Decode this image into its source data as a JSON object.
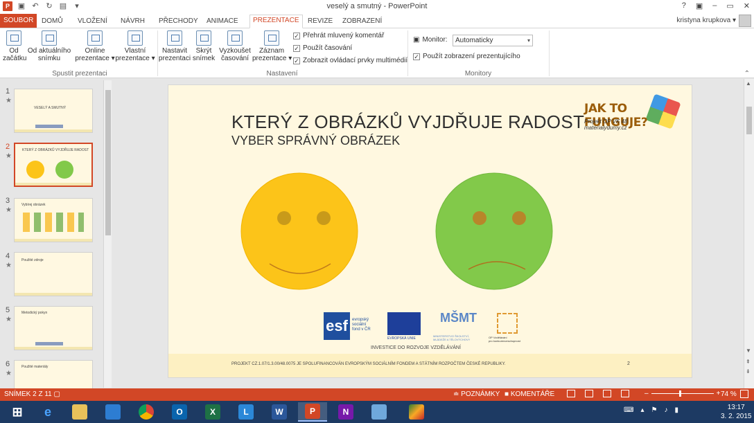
{
  "titlebar": {
    "title": "veselý a smutný - PowerPoint",
    "app_icon": "P",
    "help": "?",
    "controls": [
      "▣",
      "–",
      "▭",
      "✕"
    ]
  },
  "tabs": {
    "file": "SOUBOR",
    "items": [
      "DOMŮ",
      "VLOŽENÍ",
      "NÁVRH",
      "PŘECHODY",
      "ANIMACE",
      "PREZENTACE",
      "REVIZE",
      "ZOBRAZENÍ"
    ],
    "active": "PREZENTACE",
    "user": "kristyna krupkova ▾"
  },
  "ribbon": {
    "buttons": [
      {
        "label": "Od\nzačátku"
      },
      {
        "label": "Od aktuálního\nsnímku"
      },
      {
        "label": "Online\nprezentace ▾"
      },
      {
        "label": "Vlastní\nprezentace ▾"
      },
      {
        "label": "Nastavit\nprezentaci"
      },
      {
        "label": "Skrýt\nsnímek"
      },
      {
        "label": "Vyzkoušet\nčasování"
      },
      {
        "label": "Záznam\nprezentace ▾"
      }
    ],
    "checkboxes": [
      {
        "label": "Přehrát mluvený komentář",
        "checked": true
      },
      {
        "label": "Použít časování",
        "checked": true
      },
      {
        "label": "Zobrazit ovládací prvky multimédií",
        "checked": true
      }
    ],
    "monitor_label": "Monitor:",
    "monitor_value": "Automaticky",
    "presenter_view": {
      "label": "Použít zobrazení prezentujícího",
      "checked": true
    },
    "groups": [
      "Spustit prezentaci",
      "Nastavení",
      "Monitory"
    ]
  },
  "thumbnails": [
    {
      "num": "1",
      "title": "VESELÝ A SMUTNÝ"
    },
    {
      "num": "2",
      "title": "KTERÝ Z OBRÁZKŮ VYJDŘUJE RADOST"
    },
    {
      "num": "3",
      "title": "Vybírej obrázek"
    },
    {
      "num": "4",
      "title": "Použité zdroje"
    },
    {
      "num": "5",
      "title": "Metodický pokyn"
    },
    {
      "num": "6",
      "title": "Použité materiály"
    }
  ],
  "slide": {
    "headline": "KTERÝ Z OBRÁZKŮ VYJDŘUJE RADOST",
    "subtitle": "VYBER SPRÁVNÝ OBRÁZEK",
    "logo_title": "JAK TO FUNGUJE?",
    "logo_sub1": "Projekt OP VK 48",
    "logo_sub2": "materialydumy.cz",
    "esf_letters": "esf",
    "esf_text": "evropský\nsociální\nfond v ČR",
    "eu_text": "EVROPSKÁ UNIE",
    "msmt_letters": "MŠMT",
    "msmt_text": "MINISTERSTVO ŠKOLSTVÍ,\nMLÁDEŽE A TĚLOVÝCHOVY",
    "op_text": "OP Vzdělávání\npro konkurenceschopnost",
    "invest": "INVESTICE DO ROZVOJE VZDĚLÁVÁNÍ",
    "footer": "PROJEKT CZ.1.07/1.3.00/48.0075 JE SPOLUFINANCOVÁN EVROPSKÝM SOCIÁLNÍM FONDEM A STÁTNÍM ROZPOČTEM ČESKÉ REPUBLIKY.",
    "page": "2"
  },
  "colors": {
    "accent": "#d24726",
    "yellow_face": "#fcc419",
    "green_face": "#82c94a",
    "slide_bg": "#fff8e0",
    "taskbar": "#1d3a63"
  },
  "statusbar": {
    "slide_info": "SNÍMEK 2 Z 11",
    "notes": "≐ POZNÁMKY",
    "comments": "■ KOMENTÁŘE",
    "zoom": "74 %",
    "zoom_level": 74
  },
  "taskbar": {
    "time": "13:17",
    "date": "3. 2. 2015",
    "apps": [
      "ie-icon",
      "explorer-icon",
      "desktop-icon",
      "chrome-icon",
      "outlook-icon",
      "excel-icon",
      "lync-icon",
      "word-icon",
      "powerpoint-icon",
      "onenote-icon",
      "paint-icon",
      "image-icon"
    ]
  }
}
